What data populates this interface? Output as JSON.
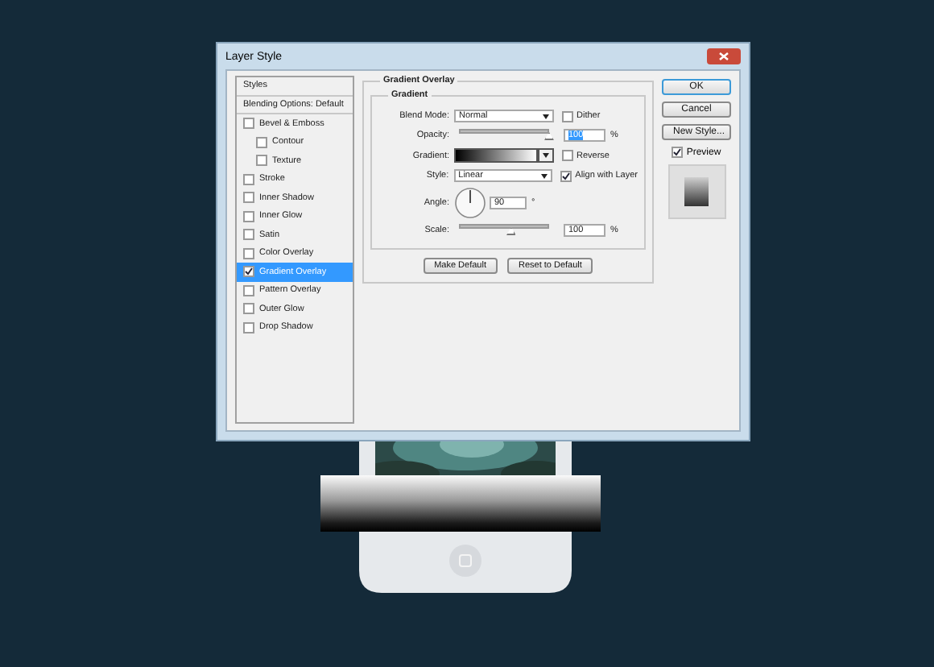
{
  "window": {
    "title": "Layer Style"
  },
  "styles": [
    {
      "kind": "header",
      "label": "Styles",
      "selected": false
    },
    {
      "kind": "header",
      "label": "Blending Options: Default",
      "selected": false
    },
    {
      "kind": "check",
      "label": "Bevel & Emboss",
      "checked": false,
      "selected": false,
      "children": [
        {
          "kind": "check",
          "label": "Contour",
          "checked": false,
          "selected": false
        },
        {
          "kind": "check",
          "label": "Texture",
          "checked": false,
          "selected": false
        }
      ]
    },
    {
      "kind": "check",
      "label": "Stroke",
      "checked": false,
      "selected": false
    },
    {
      "kind": "check",
      "label": "Inner Shadow",
      "checked": false,
      "selected": false
    },
    {
      "kind": "check",
      "label": "Inner Glow",
      "checked": false,
      "selected": false
    },
    {
      "kind": "check",
      "label": "Satin",
      "checked": false,
      "selected": false
    },
    {
      "kind": "check",
      "label": "Color Overlay",
      "checked": false,
      "selected": false
    },
    {
      "kind": "check",
      "label": "Gradient Overlay",
      "checked": true,
      "selected": true
    },
    {
      "kind": "check",
      "label": "Pattern Overlay",
      "checked": false,
      "selected": false
    },
    {
      "kind": "check",
      "label": "Outer Glow",
      "checked": false,
      "selected": false
    },
    {
      "kind": "check",
      "label": "Drop Shadow",
      "checked": false,
      "selected": false
    }
  ],
  "panel": {
    "title": "Gradient Overlay",
    "subtitle": "Gradient",
    "settings": [
      {
        "kind": "select",
        "label": "Blend Mode:",
        "value": "Normal",
        "checkbox": {
          "label": "Dither",
          "checked": false
        }
      },
      {
        "kind": "slider",
        "label": "Opacity:",
        "level": 1,
        "value": "100",
        "unit": "%",
        "highlighted": true
      },
      {
        "kind": "gradient",
        "label": "Gradient:",
        "checkbox": {
          "label": "Reverse",
          "checked": false
        }
      },
      {
        "kind": "select",
        "label": "Style:",
        "value": "Linear",
        "checkbox": {
          "label": "Align with Layer",
          "checked": true
        }
      },
      {
        "kind": "angle",
        "label": "Angle:",
        "value": "90",
        "unit": "°"
      },
      {
        "kind": "slider",
        "label": "Scale:",
        "level": 0.58,
        "value": "100",
        "unit": "%",
        "highlighted": false
      }
    ],
    "buttons": [
      "Make Default",
      "Reset to Default"
    ]
  },
  "actions": [
    {
      "label": "OK",
      "default": true
    },
    {
      "label": "Cancel",
      "default": false
    },
    {
      "label": "New Style...",
      "default": false
    }
  ],
  "preview": {
    "label": "Preview",
    "checked": true
  }
}
